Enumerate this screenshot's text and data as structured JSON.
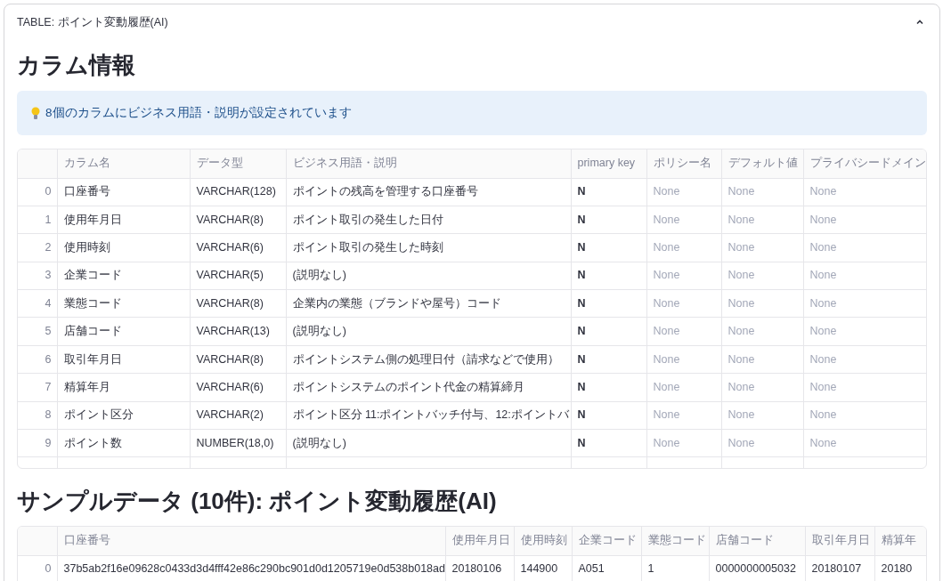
{
  "panel": {
    "title": "TABLE: ポイント変動履歴(AI)",
    "expanded": true
  },
  "column_section": {
    "heading": "カラム情報",
    "info": {
      "text": "8個のカラムにビジネス用語・説明が設定されています"
    },
    "table": {
      "columns": [
        "",
        "カラム名",
        "データ型",
        "ビジネス用語・説明",
        "primary key",
        "ポリシー名",
        "デフォルト値",
        "プライバシードメイン"
      ],
      "rows": [
        [
          "0",
          "口座番号",
          "VARCHAR(128)",
          "ポイントの残高を管理する口座番号",
          "N",
          "None",
          "None",
          "None"
        ],
        [
          "1",
          "使用年月日",
          "VARCHAR(8)",
          "ポイント取引の発生した日付",
          "N",
          "None",
          "None",
          "None"
        ],
        [
          "2",
          "使用時刻",
          "VARCHAR(6)",
          "ポイント取引の発生した時刻",
          "N",
          "None",
          "None",
          "None"
        ],
        [
          "3",
          "企業コード",
          "VARCHAR(5)",
          "(説明なし)",
          "N",
          "None",
          "None",
          "None"
        ],
        [
          "4",
          "業態コード",
          "VARCHAR(8)",
          "企業内の業態（ブランドや屋号）コード",
          "N",
          "None",
          "None",
          "None"
        ],
        [
          "5",
          "店舗コード",
          "VARCHAR(13)",
          "(説明なし)",
          "N",
          "None",
          "None",
          "None"
        ],
        [
          "6",
          "取引年月日",
          "VARCHAR(8)",
          "ポイントシステム側の処理日付（請求などで使用）",
          "N",
          "None",
          "None",
          "None"
        ],
        [
          "7",
          "精算年月",
          "VARCHAR(6)",
          "ポイントシステムのポイント代金の精算締月",
          "N",
          "None",
          "None",
          "None"
        ],
        [
          "8",
          "ポイント区分",
          "VARCHAR(2)",
          "ポイント区分 11:ポイントバッチ付与、12:ポイントバ",
          "N",
          "None",
          "None",
          "None"
        ],
        [
          "9",
          "ポイント数",
          "NUMBER(18,0)",
          "(説明なし)",
          "N",
          "None",
          "None",
          "None"
        ]
      ]
    }
  },
  "sample_section": {
    "heading": "サンプルデータ (10件): ポイント変動履歴(AI)",
    "table": {
      "columns": [
        "",
        "口座番号",
        "使用年月日",
        "使用時刻",
        "企業コード",
        "業態コード",
        "店舗コード",
        "取引年月日",
        "精算年"
      ],
      "rows": [
        [
          "0",
          "37b5ab2f16e09628c0433d3d4fff42e86c290bc901d0d1205719e0d538b018ad",
          "20180106",
          "144900",
          "A051",
          "1",
          "0000000005032",
          "20180107",
          "20180"
        ]
      ]
    }
  }
}
